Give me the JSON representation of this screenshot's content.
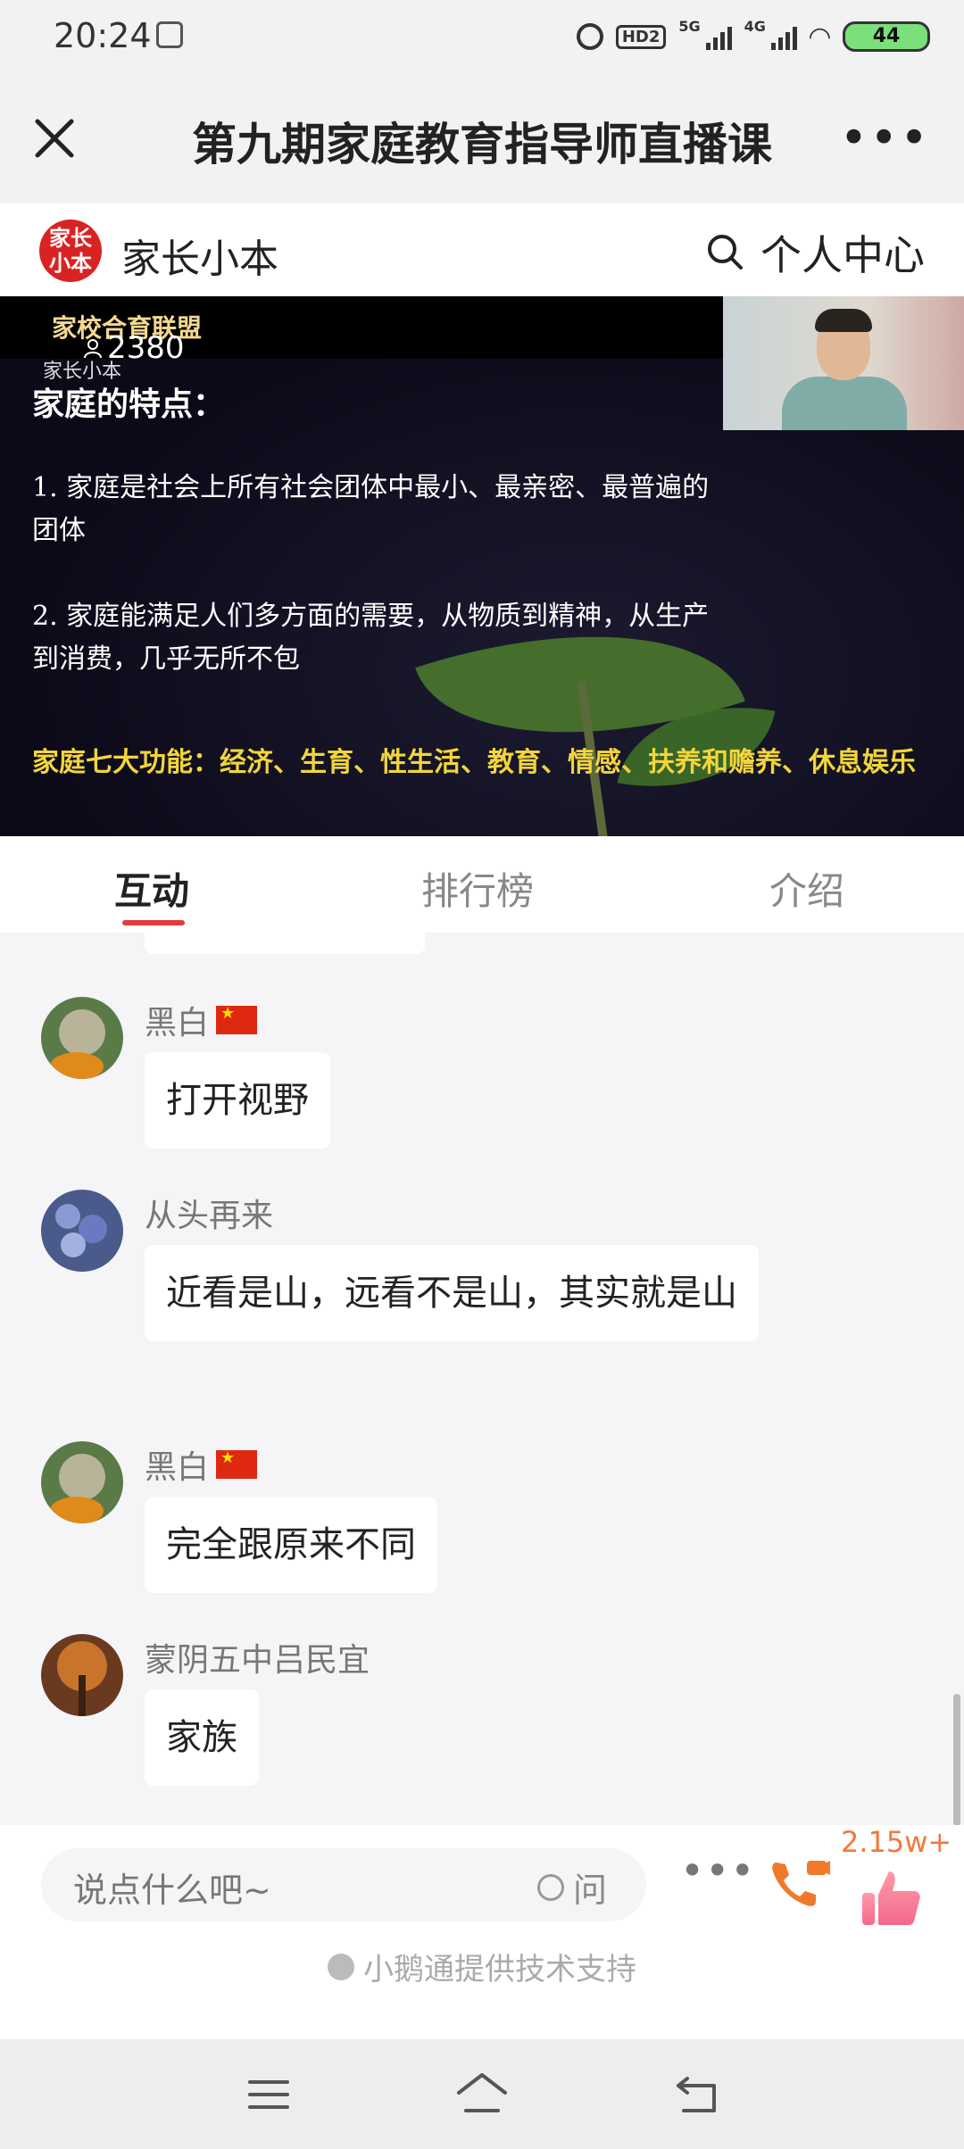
{
  "status_bar": {
    "time": "20:24",
    "hd_label": "HD2",
    "net1": "5G",
    "net2": "4G",
    "battery": "44"
  },
  "header": {
    "title": "第九期家庭教育指导师直播课"
  },
  "shop": {
    "logo_text": "家长小本",
    "name": "家长小本",
    "center_label": "个人中心"
  },
  "video": {
    "brand": "家校合育联盟",
    "brand_sub": "家长小本",
    "viewers": "2380",
    "heading": "家庭的特点：",
    "point1_line1": "1. 家庭是社会上所有社会团体中最小、最亲密、最普遍的",
    "point1_line2": "团体",
    "point2_line1": "2. 家庭能满足人们多方面的需要，从物质到精神，从生产",
    "point2_line2": "到消费，几乎无所不包",
    "functions": "家庭七大功能：经济、生育、性生活、教育、情感、扶养和赡养、休息娱乐"
  },
  "tabs": [
    {
      "label": "互动"
    },
    {
      "label": "排行榜"
    },
    {
      "label": "介绍"
    }
  ],
  "messages": [
    {
      "nick": "黑白",
      "text": "打开视野",
      "flag": true
    },
    {
      "nick": "从头再来",
      "text": "近看是山，远看不是山，其实就是山",
      "flag": false
    },
    {
      "nick": "黑白",
      "text": "完全跟原来不同",
      "flag": true
    },
    {
      "nick": "蒙阴五中吕民宜",
      "text": "家族",
      "flag": false
    }
  ],
  "input": {
    "placeholder": "说点什么吧~",
    "ask_label": "问",
    "like_count": "2.15w+"
  },
  "footer": {
    "powered_by": "小鹅通提供技术支持"
  },
  "colors": {
    "accent": "#e33b3b",
    "highlight_text": "#f2d53a",
    "like": "#f07a3a"
  }
}
